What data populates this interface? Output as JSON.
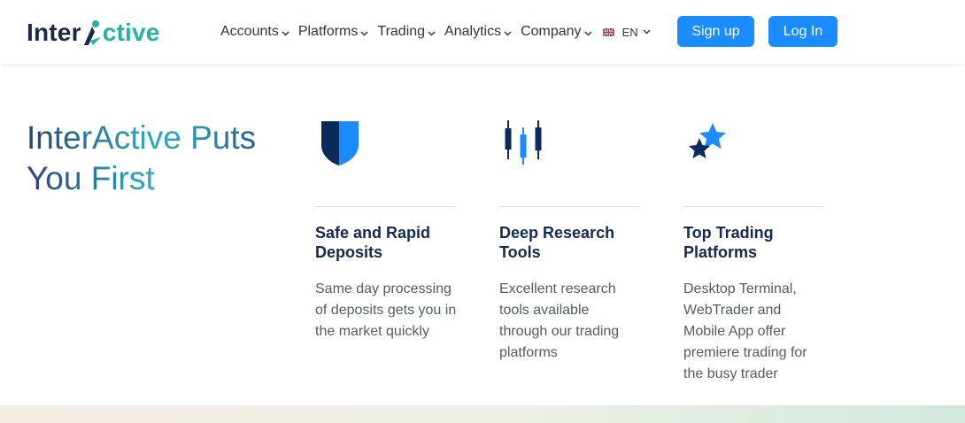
{
  "brand": {
    "name_part1": "Inter",
    "name_part2": "ctive",
    "colors": {
      "dark": "#1b2a4a",
      "teal": "#23b3a5",
      "accent_blue": "#1a8cff"
    }
  },
  "nav": {
    "items": [
      {
        "label": "Accounts"
      },
      {
        "label": "Platforms"
      },
      {
        "label": "Trading"
      },
      {
        "label": "Analytics"
      },
      {
        "label": "Company"
      }
    ],
    "language": {
      "code": "EN",
      "flag_icon": "uk-flag-icon"
    }
  },
  "auth": {
    "signup_label": "Sign up",
    "login_label": "Log In"
  },
  "hero": {
    "title_line1": "InterActive Puts",
    "title_line2": "You First"
  },
  "features": [
    {
      "icon": "shield-icon",
      "title": "Safe and Rapid Deposits",
      "description": "Same day processing of deposits gets you in the market quickly"
    },
    {
      "icon": "candlestick-icon",
      "title": "Deep Research Tools",
      "description": "Excellent research tools available through our trading platforms"
    },
    {
      "icon": "stars-icon",
      "title": "Top Trading Platforms",
      "description": "Desktop Terminal, WebTrader and Mobile App offer premiere trading for the busy trader"
    }
  ]
}
